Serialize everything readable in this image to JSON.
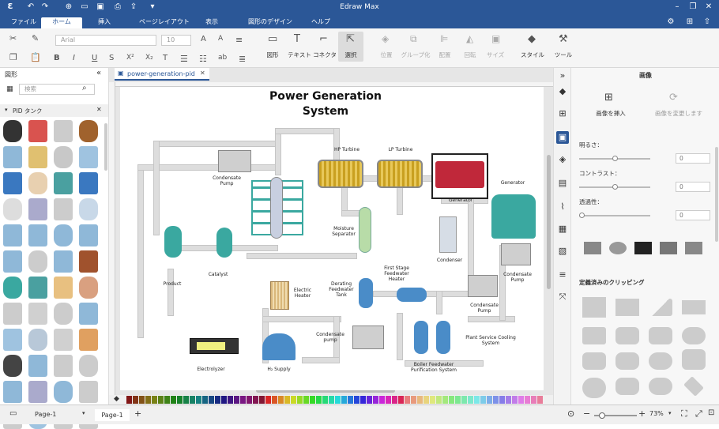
{
  "app": {
    "title": "Edraw Max"
  },
  "menu": {
    "items": [
      "ファイル",
      "ホーム",
      "挿入",
      "ページレイアウト",
      "表示",
      "図形のデザイン",
      "ヘルプ"
    ],
    "active": "ホーム"
  },
  "ribbon": {
    "font_name": "Arial",
    "font_size": "10",
    "tools": {
      "shape": "図形",
      "text": "テキスト",
      "connector": "コネクタ",
      "select": "選択",
      "position": "位置",
      "group": "グループ化",
      "align": "配置",
      "rotate": "回転",
      "size": "サイズ",
      "style": "スタイル",
      "tools": "ツール"
    }
  },
  "left_panel": {
    "title": "図形",
    "search_placeholder": "検索",
    "library": "PID タンク"
  },
  "doc": {
    "tab": "power-generation-pid"
  },
  "diagram": {
    "title_line1": "Power Generation",
    "title_line2": "System",
    "labels": {
      "hp_turbine": "HP Turbine",
      "lp_turbine": "LP Turbine",
      "generator_red": "Generator",
      "generator": "Generator",
      "condensate_pump_top": "Condensate\nPump",
      "moisture_separator": "Moisture\nSeparator",
      "condenser": "Condenser",
      "condensate_pump_right": "Condensate\nPump",
      "first_stage": "First Stage\nFeedwater\nHeater",
      "deaerating": "Derating\nFeedwater\nTank",
      "condensate_pump_mid": "Condensate\nPump",
      "product": "Product",
      "catalyst": "Catalyst",
      "electric_heater": "Electric\nHeater",
      "condensate_pump_low": "Condensate\npump",
      "plant_cooling": "Plant Service Cooling\nSystem",
      "boiler": "Boiler Feedwater\nPurification System",
      "electrolyzer": "Electrolyzer",
      "h2_supply": "H₂ Supply"
    }
  },
  "right_panel": {
    "title": "画像",
    "insert": "画像を挿入",
    "change": "画像を変更します",
    "brightness": "明るさ：",
    "contrast": "コントラスト：",
    "transparency": "透過性：",
    "brightness_val": "0",
    "contrast_val": "0",
    "transparency_val": "0",
    "clipping": "定義済みのクリッピング"
  },
  "status": {
    "page_select": "Page-1",
    "page_tab": "Page-1",
    "zoom": "73%"
  },
  "colors": {
    "brand": "#2b5797",
    "teal": "#3aa8a0",
    "blue_tank": "#4a8cc8",
    "red_gen": "#c0283a"
  }
}
